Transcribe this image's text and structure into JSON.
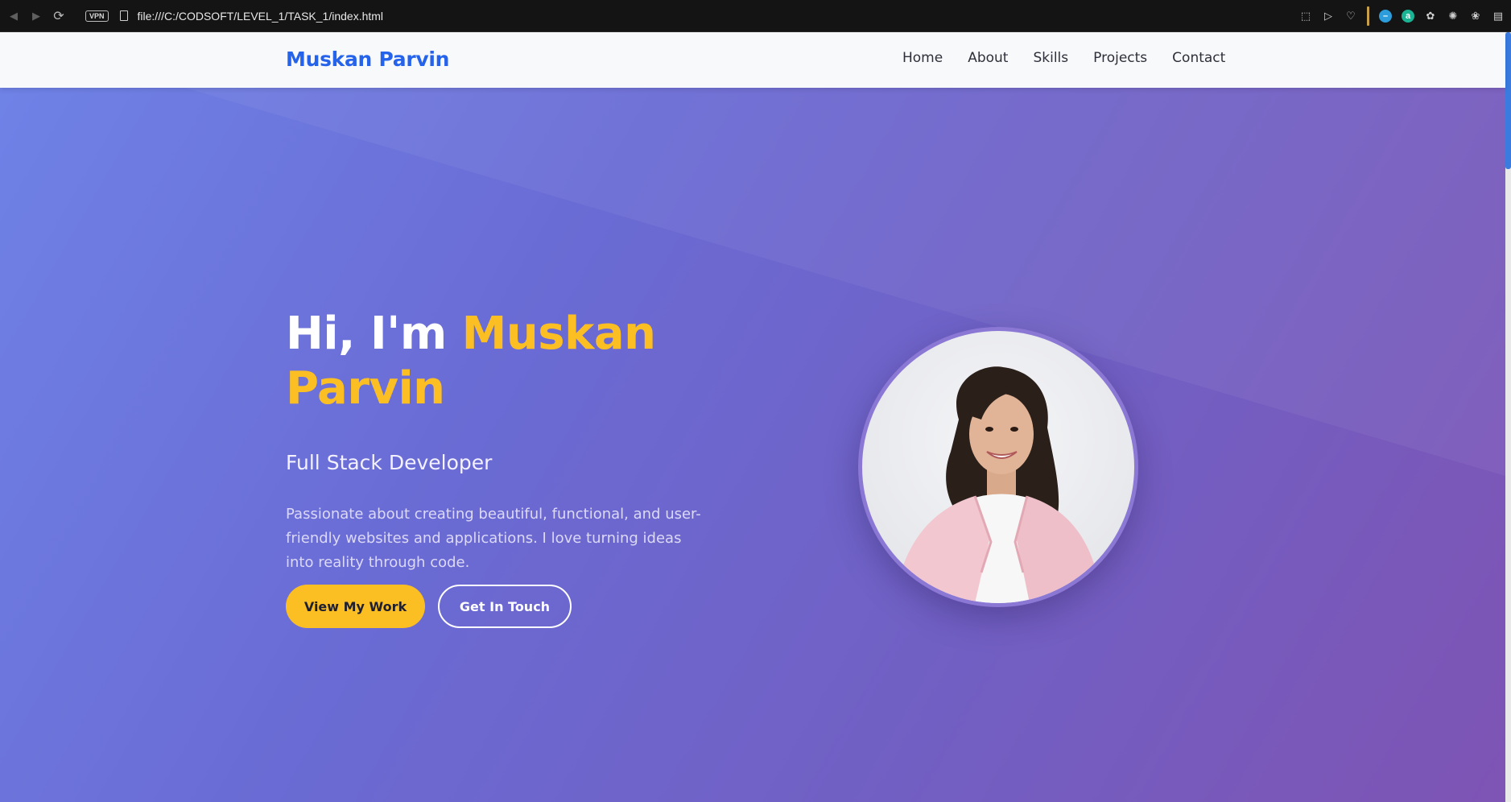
{
  "browser": {
    "url": "file:///C:/CODSOFT/LEVEL_1/TASK_1/index.html",
    "vpn_label": "VPN",
    "icons": [
      "back-icon",
      "forward-icon",
      "reload-icon",
      "page-icon",
      "screenshot-icon",
      "play-icon",
      "heart-icon",
      "extension-blue-icon",
      "extension-a-icon",
      "extension-puzzle-icon",
      "extension-spark-icon",
      "extension-cat-icon",
      "reading-list-icon"
    ],
    "ext_a_label": "a"
  },
  "nav": {
    "brand": "Muskan Parvin",
    "links": [
      "Home",
      "About",
      "Skills",
      "Projects",
      "Contact"
    ]
  },
  "hero": {
    "greeting": "Hi, I'm ",
    "name": "Muskan Parvin",
    "name_first": "Muskan",
    "name_last": "Parvin",
    "subtitle": "Full Stack Developer",
    "description": "Passionate about creating beautiful, functional, and user-friendly websites and applications. I love turning ideas into reality through code.",
    "primary_button": "View My Work",
    "secondary_button": "Get In Touch"
  },
  "colors": {
    "brand": "#2563eb",
    "accent": "#fbbf24",
    "hero_gradient_start": "#6f82e6",
    "hero_gradient_end": "#7e54b4"
  }
}
